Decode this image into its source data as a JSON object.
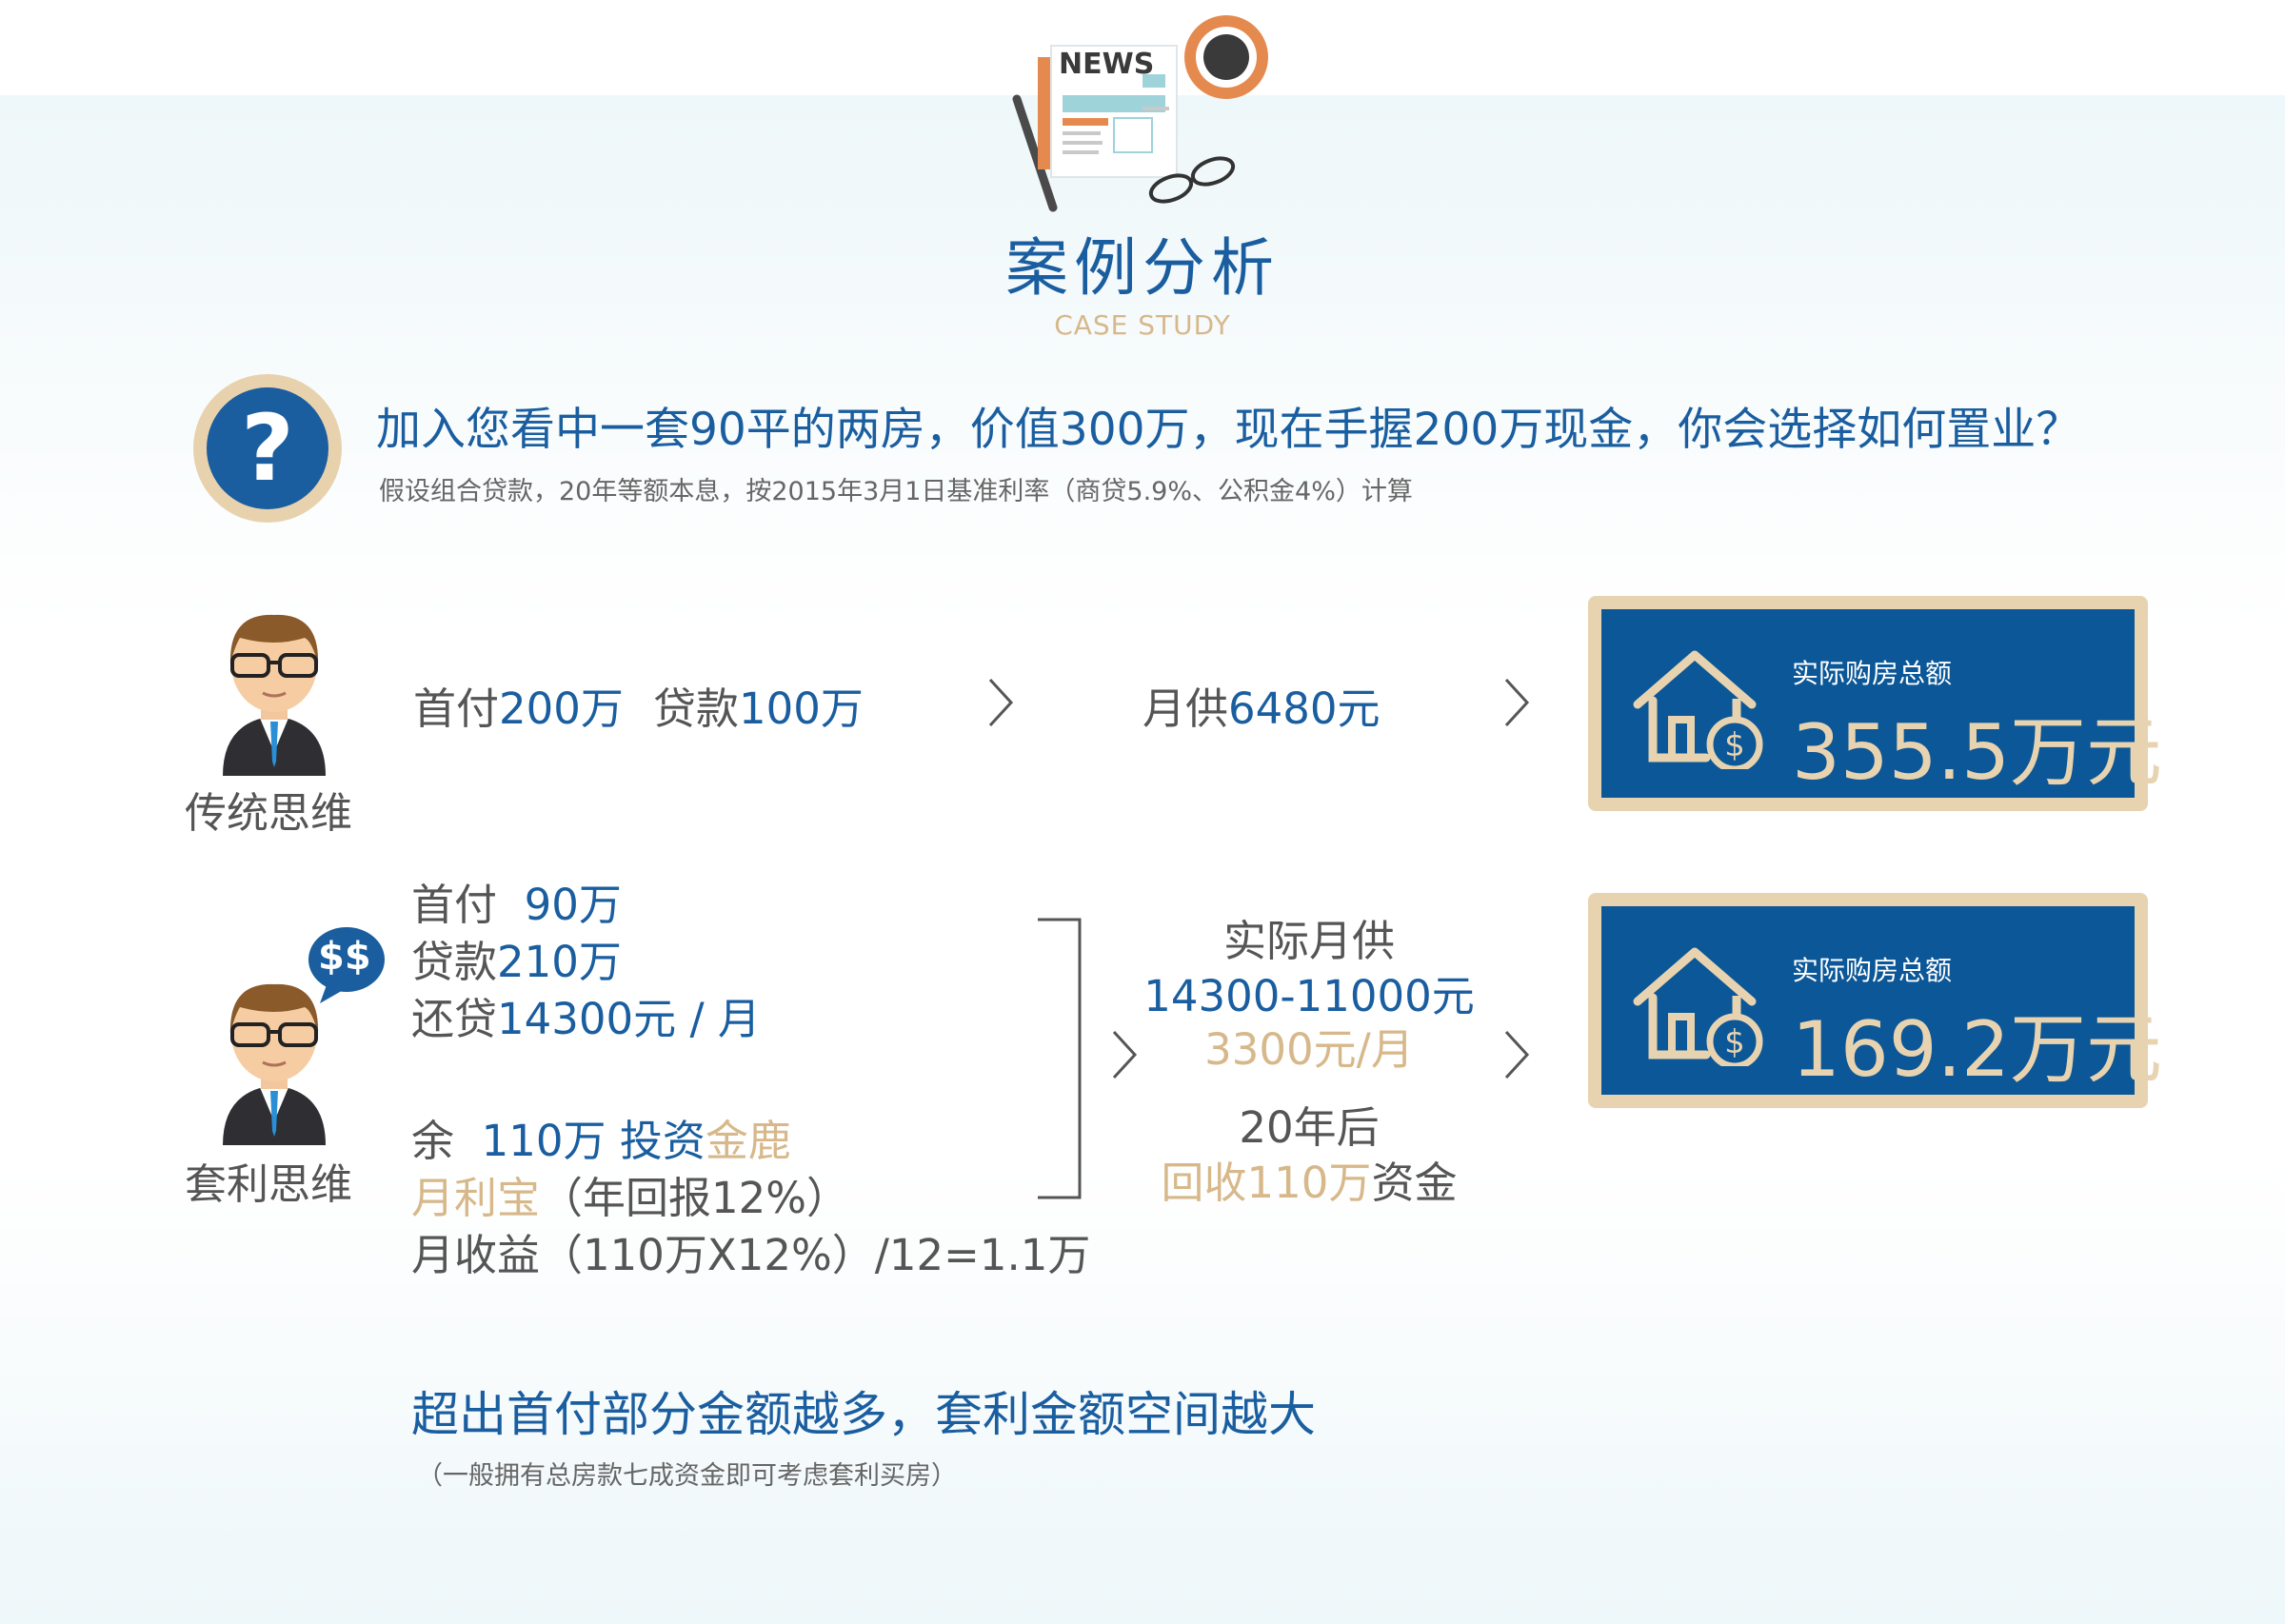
{
  "header": {
    "news_label": "NEWS",
    "title": "案例分析",
    "subtitle": "CASE STUDY"
  },
  "question": {
    "main": "加入您看中一套90平的两房，价值300万，现在手握200万现金，你会选择如何置业？",
    "note": "假设组合贷款，20年等额本息，按2015年3月1日基准利率（商贷5.9%、公积金4%）计算"
  },
  "traditional": {
    "label": "传统思维",
    "down_prefix": "首付",
    "down_value": "200万",
    "loan_prefix": "贷款",
    "loan_value": "100万",
    "monthly_prefix": "月供",
    "monthly_value": "6480元",
    "result_label": "实际购房总额",
    "result_value": "355.5万元"
  },
  "arbitrage": {
    "label": "套利思维",
    "speech": "$$",
    "line1_prefix": "首付",
    "line1_value": "90万",
    "line2_prefix": "贷款",
    "line2_value": "210万",
    "line3_prefix": "还贷",
    "line3_value": "14300元 / 月",
    "line4_prefix": "余",
    "line4_value": "110万 投资",
    "line4_highlight": "金鹿",
    "line5_highlight": "月利宝",
    "line5_rest": "（年回报12%）",
    "line6": "月收益（110万X12%）/12=1.1万",
    "mid_title": "实际月供",
    "mid_range": "14300-11000元",
    "mid_diff": "3300元/月",
    "mid_years": "20年后",
    "mid_recover_highlight": "回收110万",
    "mid_recover_rest": "资金",
    "result_label": "实际购房总额",
    "result_value": "169.2万元"
  },
  "footer": {
    "headline": "超出首付部分金额越多，套利金额空间越大",
    "note": "（一般拥有总房款七成资金即可考虑套利买房）"
  },
  "colors": {
    "primary_blue": "#1a5ea0",
    "box_blue": "#0b5797",
    "tan": "#d7b88a",
    "text_gray": "#555555"
  }
}
